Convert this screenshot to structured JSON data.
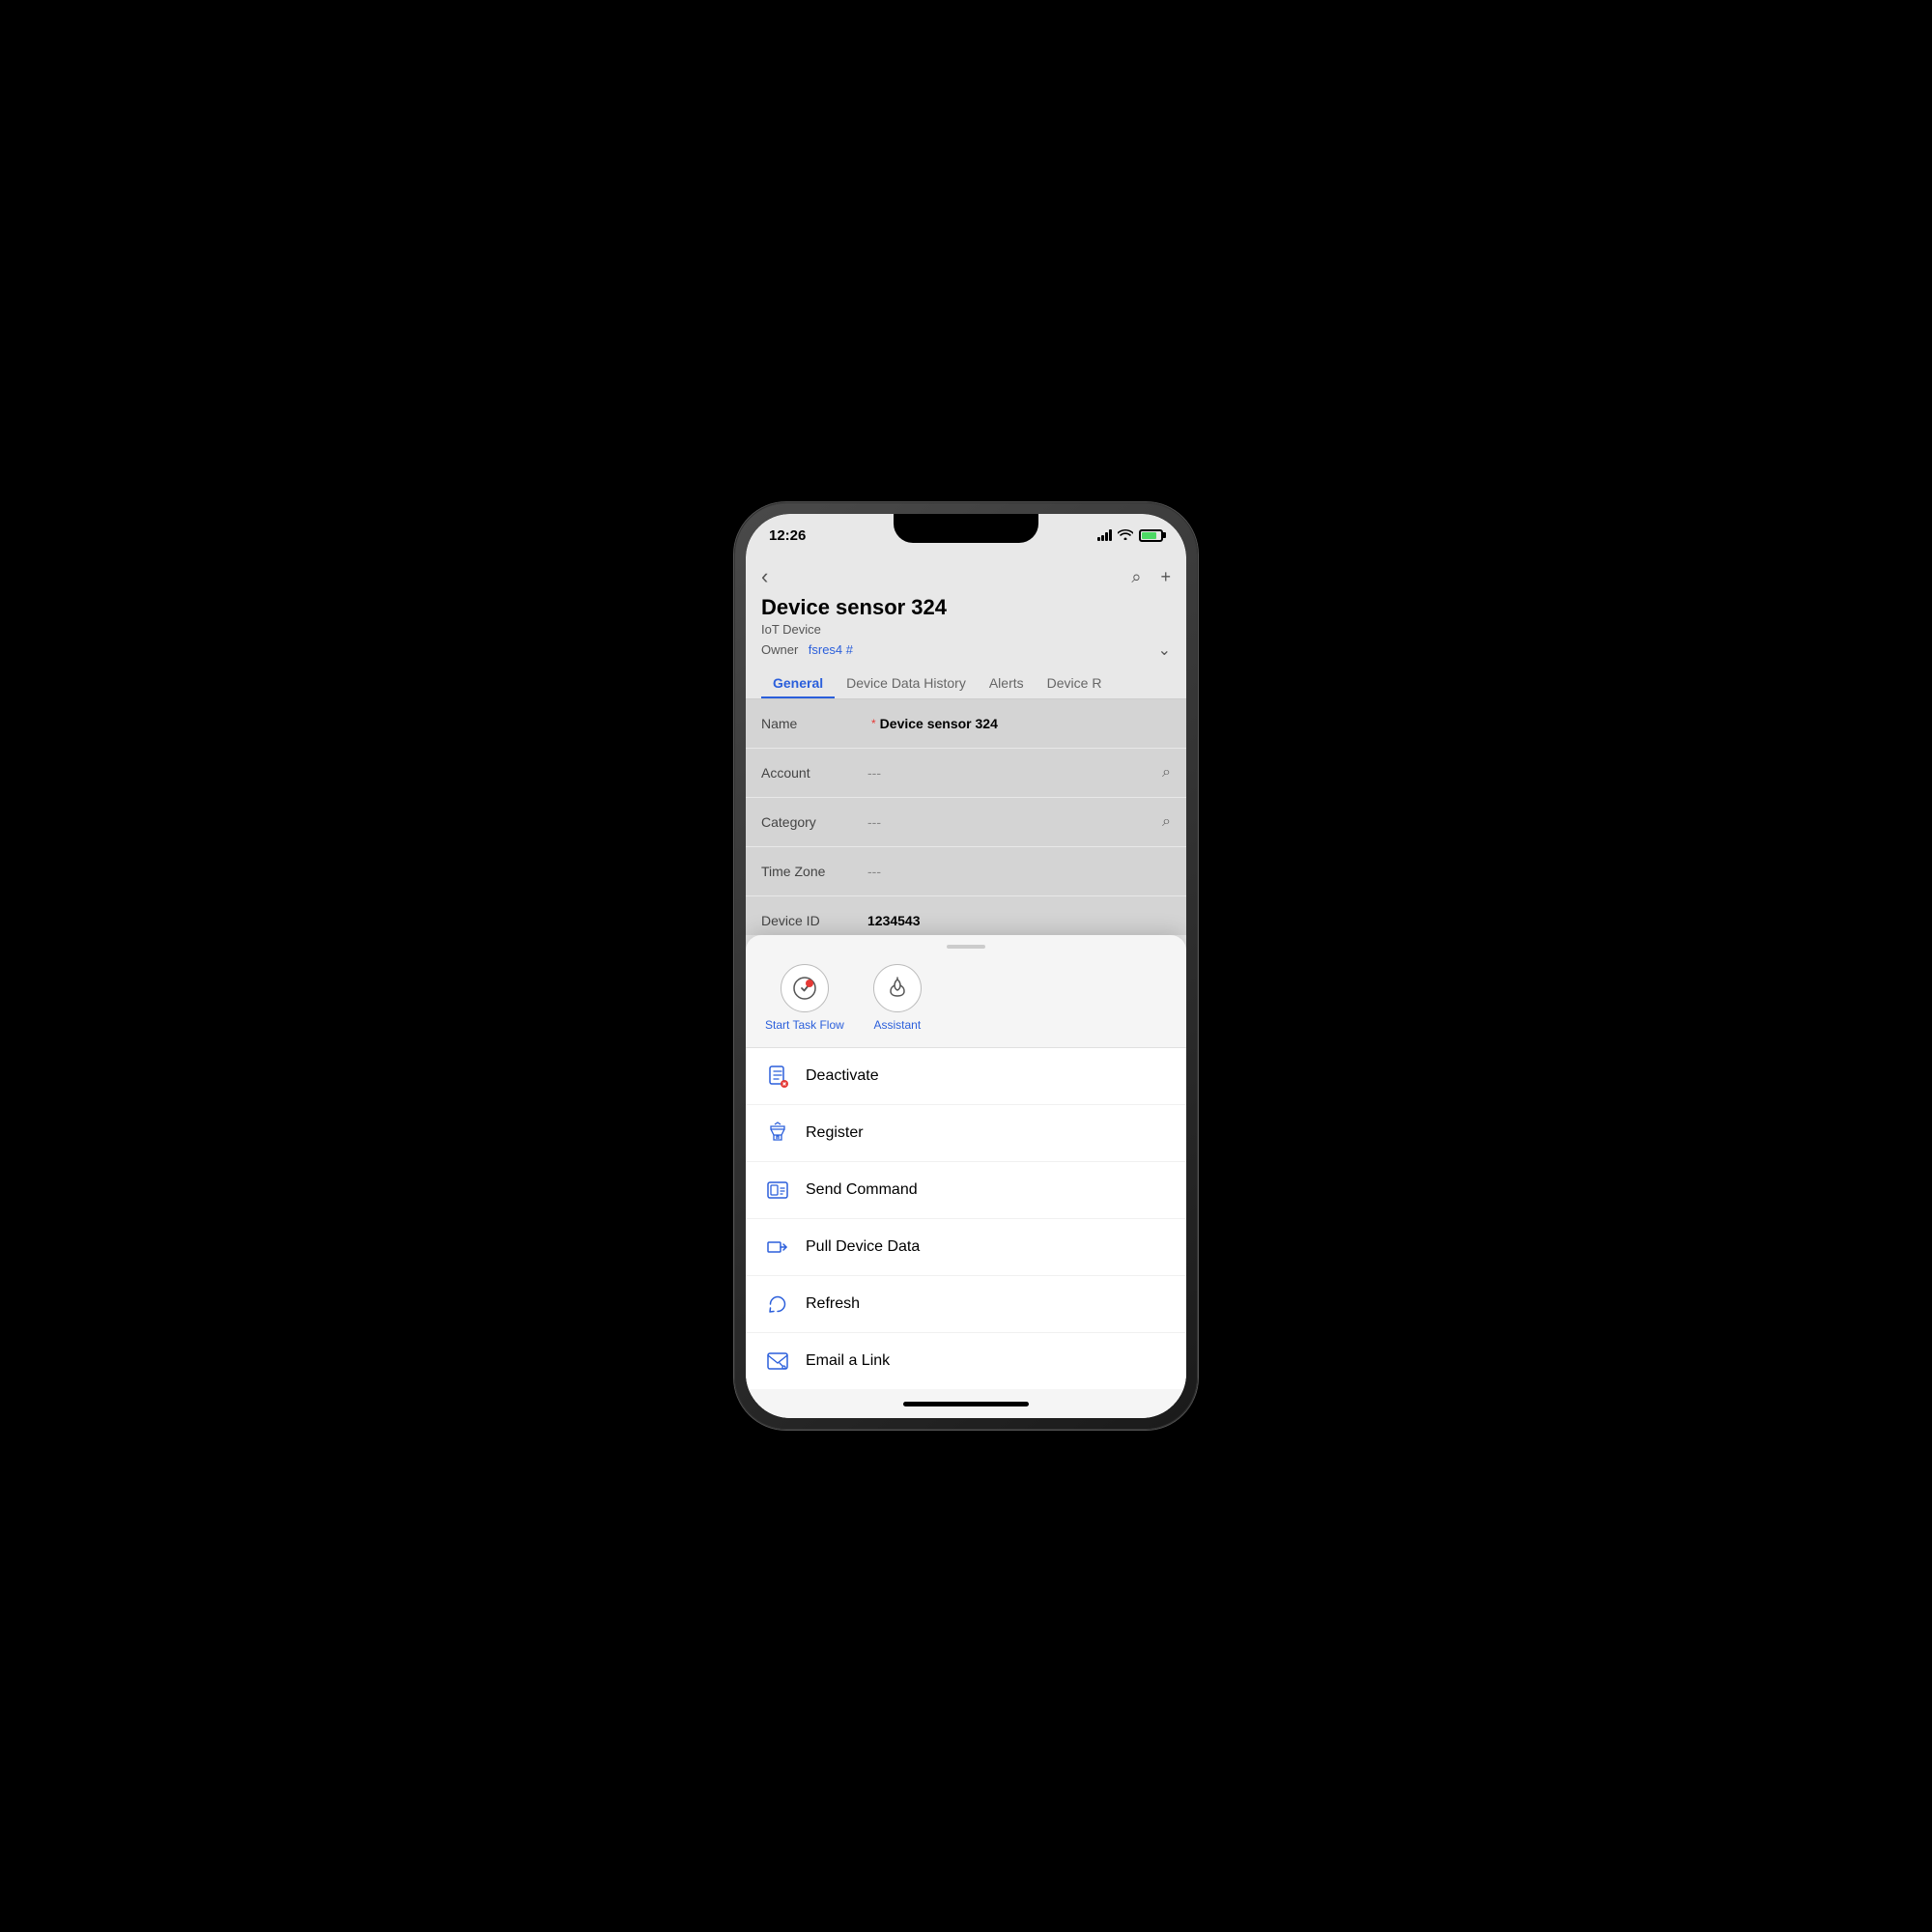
{
  "statusBar": {
    "time": "12:26"
  },
  "header": {
    "backIcon": "‹",
    "searchIcon": "⌕",
    "addIcon": "+",
    "title": "Device sensor 324",
    "subtitle": "IoT Device",
    "ownerLabel": "Owner",
    "ownerValue": "fsres4 #",
    "expandIcon": "∨"
  },
  "tabs": [
    {
      "label": "General",
      "active": true
    },
    {
      "label": "Device Data History",
      "active": false
    },
    {
      "label": "Alerts",
      "active": false
    },
    {
      "label": "Device R",
      "active": false
    }
  ],
  "fields": [
    {
      "label": "Name",
      "required": true,
      "value": "Device sensor 324",
      "isEmpty": false,
      "hasSearch": false
    },
    {
      "label": "Account",
      "required": false,
      "value": "---",
      "isEmpty": true,
      "hasSearch": true
    },
    {
      "label": "Category",
      "required": false,
      "value": "---",
      "isEmpty": true,
      "hasSearch": true
    },
    {
      "label": "Time Zone",
      "required": false,
      "value": "---",
      "isEmpty": true,
      "hasSearch": false
    },
    {
      "label": "Device ID",
      "required": false,
      "value": "1234543",
      "isEmpty": false,
      "hasSearch": false
    }
  ],
  "quickActions": [
    {
      "icon": "✓",
      "label": "Start Task Flow",
      "iconStyle": "task"
    },
    {
      "icon": "💡",
      "label": "Assistant",
      "iconStyle": "light"
    }
  ],
  "menuItems": [
    {
      "icon": "deactivate",
      "label": "Deactivate"
    },
    {
      "icon": "register",
      "label": "Register"
    },
    {
      "icon": "command",
      "label": "Send Command"
    },
    {
      "icon": "pull",
      "label": "Pull Device Data"
    },
    {
      "icon": "refresh",
      "label": "Refresh"
    },
    {
      "icon": "email",
      "label": "Email a Link"
    }
  ]
}
